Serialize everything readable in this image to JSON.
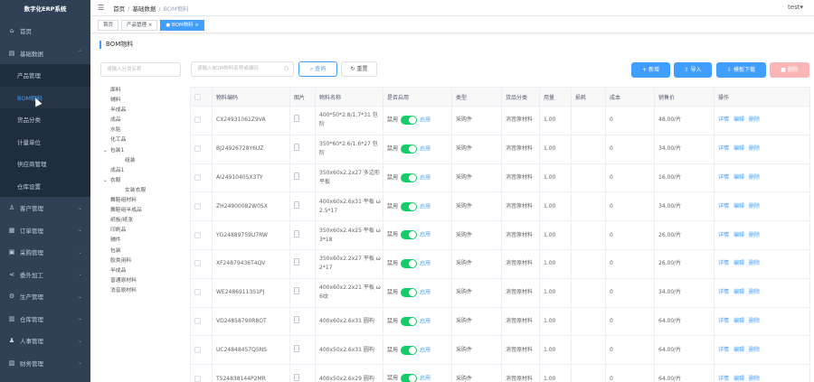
{
  "app": {
    "title": "数字化ERP系统"
  },
  "sidebar": {
    "items": [
      {
        "icon": "home-icon",
        "label": "首页",
        "expandable": false
      },
      {
        "icon": "document-icon",
        "label": "基础数据",
        "expandable": true,
        "expanded": true,
        "children": [
          "产品管理",
          "BOM物料",
          "货品分类",
          "计量单位",
          "供应商管理",
          "仓库设置"
        ]
      },
      {
        "icon": "user-icon",
        "label": "客户管理",
        "expandable": true
      },
      {
        "icon": "order-icon",
        "label": "订单管理",
        "expandable": true
      },
      {
        "icon": "purchase-icon",
        "label": "采购管理",
        "expandable": true
      },
      {
        "icon": "share-icon",
        "label": "委外加工",
        "expandable": true
      },
      {
        "icon": "production-icon",
        "label": "生产管理",
        "expandable": true
      },
      {
        "icon": "warehouse-icon",
        "label": "仓库管理",
        "expandable": true
      },
      {
        "icon": "person-icon",
        "label": "人事管理",
        "expandable": true
      },
      {
        "icon": "finance-icon",
        "label": "财务管理",
        "expandable": true
      }
    ],
    "active_child": "BOM物料"
  },
  "header": {
    "breadcrumb": [
      "首页",
      "基础数据",
      "BOM物料"
    ],
    "user": "test"
  },
  "tabs": [
    {
      "label": "首页",
      "active": false
    },
    {
      "label": "产品管理 ×",
      "active": false
    },
    {
      "label": "● BOM物料 ×",
      "active": true
    }
  ],
  "page": {
    "title": "BOM物料"
  },
  "category": {
    "search_placeholder": "请输入分类名称",
    "tree": [
      {
        "label": "面料",
        "level": 0,
        "arrow": ""
      },
      {
        "label": "辅料",
        "level": 0,
        "arrow": ""
      },
      {
        "label": "半成品",
        "level": 0,
        "arrow": ""
      },
      {
        "label": "成品",
        "level": 0,
        "arrow": ""
      },
      {
        "label": "水贴",
        "level": 0,
        "arrow": ""
      },
      {
        "label": "化工品",
        "level": 0,
        "arrow": ""
      },
      {
        "label": "包装1",
        "level": 0,
        "arrow": "⌄"
      },
      {
        "label": "组装",
        "level": 1,
        "arrow": ""
      },
      {
        "label": "成品1",
        "level": 0,
        "arrow": ""
      },
      {
        "label": "衣服",
        "level": 0,
        "arrow": "⌄"
      },
      {
        "label": "女装衣服",
        "level": 1,
        "arrow": ""
      },
      {
        "label": "舞鞋组材料",
        "level": 0,
        "arrow": ""
      },
      {
        "label": "舞鞋组半成品",
        "level": 0,
        "arrow": ""
      },
      {
        "label": "纸板/纸张",
        "level": 0,
        "arrow": ""
      },
      {
        "label": "印刷品",
        "level": 0,
        "arrow": ""
      },
      {
        "label": "辅件",
        "level": 0,
        "arrow": ""
      },
      {
        "label": "包装",
        "level": 0,
        "arrow": ""
      },
      {
        "label": "胶类用料",
        "level": 0,
        "arrow": ""
      },
      {
        "label": "半成品",
        "level": 0,
        "arrow": ""
      },
      {
        "label": "普通原材料",
        "level": 0,
        "arrow": ""
      },
      {
        "label": "消音原材料",
        "level": 0,
        "arrow": ""
      }
    ]
  },
  "toolbar": {
    "search_placeholder": "请输入BOM物料名称或编码",
    "query_label": "查询",
    "reset_label": "重置",
    "add_label": "新增",
    "import_label": "导入",
    "template_label": "模板下载",
    "delete_label": "删除"
  },
  "table": {
    "columns": [
      "",
      "物料编码",
      "图片",
      "物料名称",
      "是否启用",
      "类型",
      "货品分类",
      "用量",
      "损耗",
      "成本",
      "销售价",
      "操作"
    ],
    "switch_off_label": "禁用",
    "switch_on_label": "启用",
    "actions": [
      "详情",
      "编辑",
      "删除"
    ],
    "rows": [
      {
        "code": "CX24931061Z9VA",
        "name": "400*50*2.8/1.7*31 包阶",
        "type": "采购件",
        "category": "消音原材料",
        "qty": "1.00",
        "loss": "",
        "cost": "0",
        "price": "48.00/片"
      },
      {
        "code": "BJ24926728Y6UZ",
        "name": "350*60*2.6/1.6*27 包阶",
        "type": "采购件",
        "category": "消音原材料",
        "qty": "1.00",
        "loss": "",
        "cost": "0",
        "price": "34.00/片"
      },
      {
        "code": "AI24910405X3TY",
        "name": "350x60x2.2x27 多边形平板",
        "type": "采购件",
        "category": "消音原材料",
        "qty": "1.00",
        "loss": "",
        "cost": "0",
        "price": "16.00/片"
      },
      {
        "code": "ZH24900082W0SX",
        "name": "400x60x2.6x31 平板 ω 2.5*17",
        "type": "采购件",
        "category": "消音原材料",
        "qty": "1.00",
        "loss": "",
        "cost": "0",
        "price": "34.00/片"
      },
      {
        "code": "YG24889759U7RW",
        "name": "350x60x2.4x25 平板 ω 3*18",
        "type": "采购件",
        "category": "消音原材料",
        "qty": "1.00",
        "loss": "",
        "cost": "0",
        "price": "26.00/片"
      },
      {
        "code": "XF24879436T4QV",
        "name": "350x60x2.2x27 平板 ω 2*17",
        "type": "采购件",
        "category": "消音原材料",
        "qty": "1.00",
        "loss": "",
        "cost": "0",
        "price": "26.00/片"
      },
      {
        "code": "WE24869113S1PJ",
        "name": "400x60x2.2x21 平板 ω 6纹",
        "type": "采购件",
        "category": "消音原材料",
        "qty": "1.00",
        "loss": "",
        "cost": "0",
        "price": "34.00/片"
      },
      {
        "code": "VD24858790R8OT",
        "name": "400x60x2.6x31 圆构",
        "type": "采购件",
        "category": "消音原材料",
        "qty": "1.00",
        "loss": "",
        "cost": "0",
        "price": "64.00/片"
      },
      {
        "code": "UC24848457Q5NS",
        "name": "400x50x2.6x31 圆构",
        "type": "采购件",
        "category": "消音原材料",
        "qty": "1.00",
        "loss": "",
        "cost": "0",
        "price": "64.00/片"
      },
      {
        "code": "TS24838144P2MR",
        "name": "400x50x2.6x29 圆构",
        "type": "采购件",
        "category": "消音原材料",
        "qty": "1.00",
        "loss": "",
        "cost": "0",
        "price": "64.00/片"
      }
    ]
  },
  "colors": {
    "sidebar_bg": "#304156",
    "accent": "#409eff",
    "switch_on": "#13ce66",
    "danger": "#f56c6c"
  }
}
